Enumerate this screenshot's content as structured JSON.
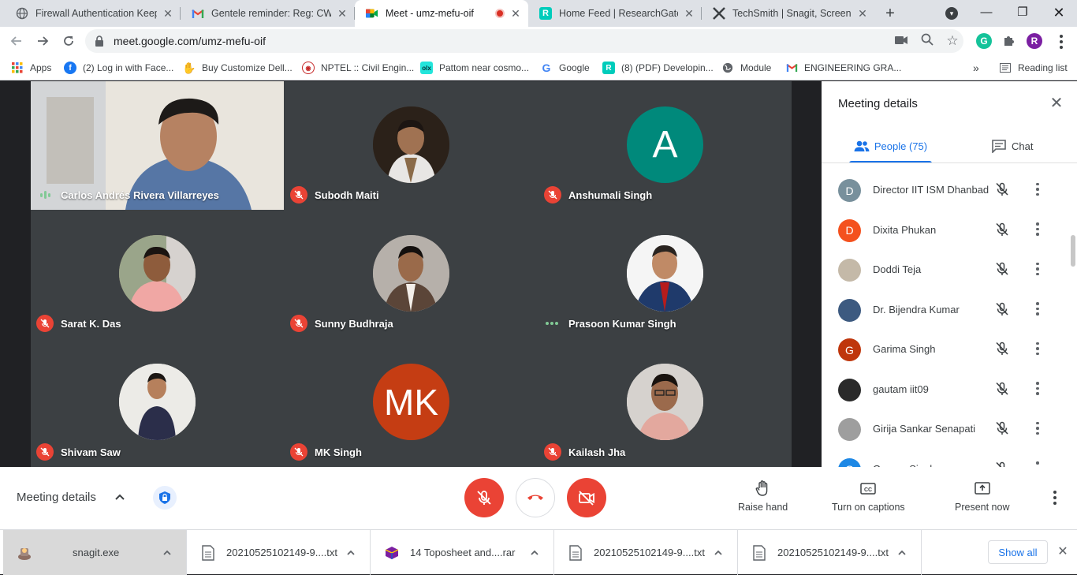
{
  "browser": {
    "tabs": [
      {
        "title": "Firewall Authentication Keepa",
        "icon": "globe-icon"
      },
      {
        "title": "Gentele reminder: Reg: CWRN",
        "icon": "gmail-icon"
      },
      {
        "title": "Meet - umz-mefu-oif",
        "icon": "meet-icon",
        "active": true,
        "recording": true
      },
      {
        "title": "Home Feed | ResearchGate",
        "icon": "researchgate-icon"
      },
      {
        "title": "TechSmith | Snagit, Screen Ca",
        "icon": "techsmith-icon"
      }
    ],
    "url": "meet.google.com/umz-mefu-oif",
    "profile_initial": "R",
    "bookmarks": [
      {
        "label": "Apps",
        "icon": "apps-grid-icon"
      },
      {
        "label": "(2) Log in with Face...",
        "icon": "facebook-icon"
      },
      {
        "label": "Buy Customize Dell...",
        "icon": "dell-icon"
      },
      {
        "label": "NPTEL :: Civil Engin...",
        "icon": "nptel-icon"
      },
      {
        "label": "Pattom near cosmo...",
        "icon": "olx-icon"
      },
      {
        "label": "Google",
        "icon": "google-icon"
      },
      {
        "label": "(8) (PDF) Developin...",
        "icon": "researchgate-icon"
      },
      {
        "label": "Module",
        "icon": "globe-icon"
      },
      {
        "label": "ENGINEERING GRA...",
        "icon": "gmail-icon"
      }
    ],
    "reading_list": "Reading list"
  },
  "meeting": {
    "participants": [
      {
        "name": "Carlos Andrés Rivera Villarreyes",
        "status": "speaking",
        "type": "video"
      },
      {
        "name": "Subodh Maiti",
        "status": "muted",
        "type": "photo",
        "color": "#5a4a3a"
      },
      {
        "name": "Anshumali Singh",
        "status": "muted",
        "type": "initial",
        "initial": "A",
        "color": "#00897b"
      },
      {
        "name": "Sarat K. Das",
        "status": "muted",
        "type": "photo",
        "color": "#c9a38f"
      },
      {
        "name": "Sunny Budhraja",
        "status": "muted",
        "type": "photo",
        "color": "#8a8076"
      },
      {
        "name": "Prasoon Kumar Singh",
        "status": "connecting",
        "type": "photo",
        "color": "#1f3a6b"
      },
      {
        "name": "Shivam Saw",
        "status": "muted",
        "type": "photo",
        "color": "#2b2e4a"
      },
      {
        "name": "MK Singh",
        "status": "muted",
        "type": "initial",
        "initial": "MK",
        "color": "#c53d13"
      },
      {
        "name": "Kailash Jha",
        "status": "muted",
        "type": "photo",
        "color": "#d6a6a0"
      }
    ]
  },
  "panel": {
    "title": "Meeting details",
    "people_tab": "People (75)",
    "chat_tab": "Chat",
    "people": [
      {
        "name": "Director IIT ISM Dhanbad",
        "initial": "D",
        "color": "#78909c"
      },
      {
        "name": "Dixita Phukan",
        "initial": "D",
        "color": "#f4511e"
      },
      {
        "name": "Doddi Teja",
        "initial": "",
        "color": "#c4b9a8"
      },
      {
        "name": "Dr. Bijendra Kumar",
        "initial": "",
        "color": "#3d5a80"
      },
      {
        "name": "Garima Singh",
        "initial": "G",
        "color": "#bf360c"
      },
      {
        "name": "gautam iit09",
        "initial": "",
        "color": "#2a2a2a"
      },
      {
        "name": "Girija Sankar Senapati",
        "initial": "",
        "color": "#9e9e9e"
      },
      {
        "name": "Gaurav Singh",
        "initial": "G",
        "color": "#1e88e5"
      }
    ]
  },
  "controls": {
    "meeting_details": "Meeting details",
    "raise_hand": "Raise hand",
    "captions": "Turn on captions",
    "present": "Present now"
  },
  "downloads": {
    "items": [
      {
        "name": "snagit.exe",
        "icon": "exe-icon",
        "selected": true
      },
      {
        "name": "20210525102149-9....txt",
        "icon": "file-icon"
      },
      {
        "name": "14 Toposheet and....rar",
        "icon": "rar-icon"
      },
      {
        "name": "20210525102149-9....txt",
        "icon": "file-icon"
      },
      {
        "name": "20210525102149-9....txt",
        "icon": "file-icon"
      }
    ],
    "show_all": "Show all"
  },
  "colors": {
    "meet_red": "#ea4335",
    "accent_blue": "#1a73e8",
    "stage_bg": "#202124",
    "tile_bg": "#3c4043"
  }
}
